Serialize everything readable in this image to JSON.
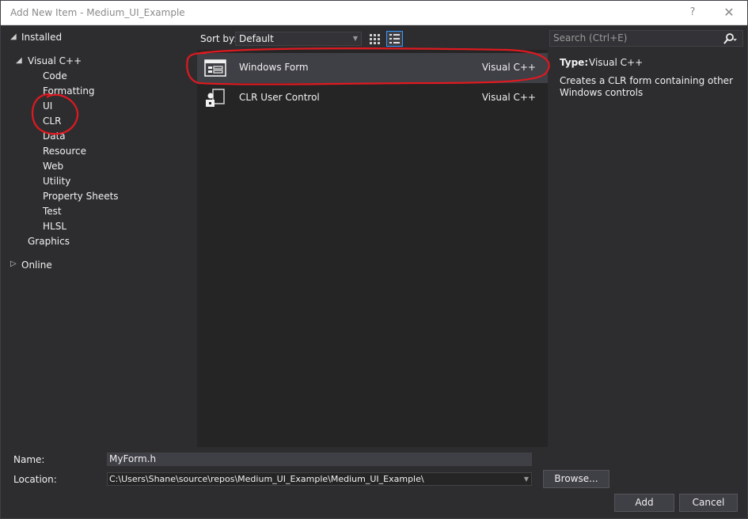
{
  "window": {
    "title": "Add New Item - Medium_UI_Example",
    "help_glyph": "?",
    "close_glyph": "✕"
  },
  "tree": {
    "installed": "Installed",
    "visual_cpp": "Visual C++",
    "children": [
      "Code",
      "Formatting",
      "UI",
      "CLR",
      "Data",
      "Resource",
      "Web",
      "Utility",
      "Property Sheets",
      "Test",
      "HLSL"
    ],
    "graphics": "Graphics",
    "online": "Online"
  },
  "sort": {
    "label": "Sort by:",
    "value": "Default"
  },
  "templates": [
    {
      "name": "Windows Form",
      "language": "Visual C++",
      "icon": "windows-form-icon",
      "selected": true
    },
    {
      "name": "CLR User Control",
      "language": "Visual C++",
      "icon": "user-control-icon",
      "selected": false
    }
  ],
  "search": {
    "placeholder": "Search (Ctrl+E)"
  },
  "details": {
    "type_label": "Type:",
    "type_value": "Visual C++",
    "description": "Creates a CLR form containing other Windows controls"
  },
  "bottom": {
    "name_label": "Name:",
    "name_value": "MyForm.h",
    "location_label": "Location:",
    "location_value": "C:\\Users\\Shane\\source\\repos\\Medium_UI_Example\\Medium_UI_Example\\",
    "browse_label": "Browse...",
    "add_label": "Add",
    "cancel_label": "Cancel"
  },
  "colors": {
    "background": "#2d2d30",
    "list_background": "#252526",
    "selected_row": "#3f3f46",
    "accent": "#3399ff",
    "annotation": "#e0191f"
  }
}
